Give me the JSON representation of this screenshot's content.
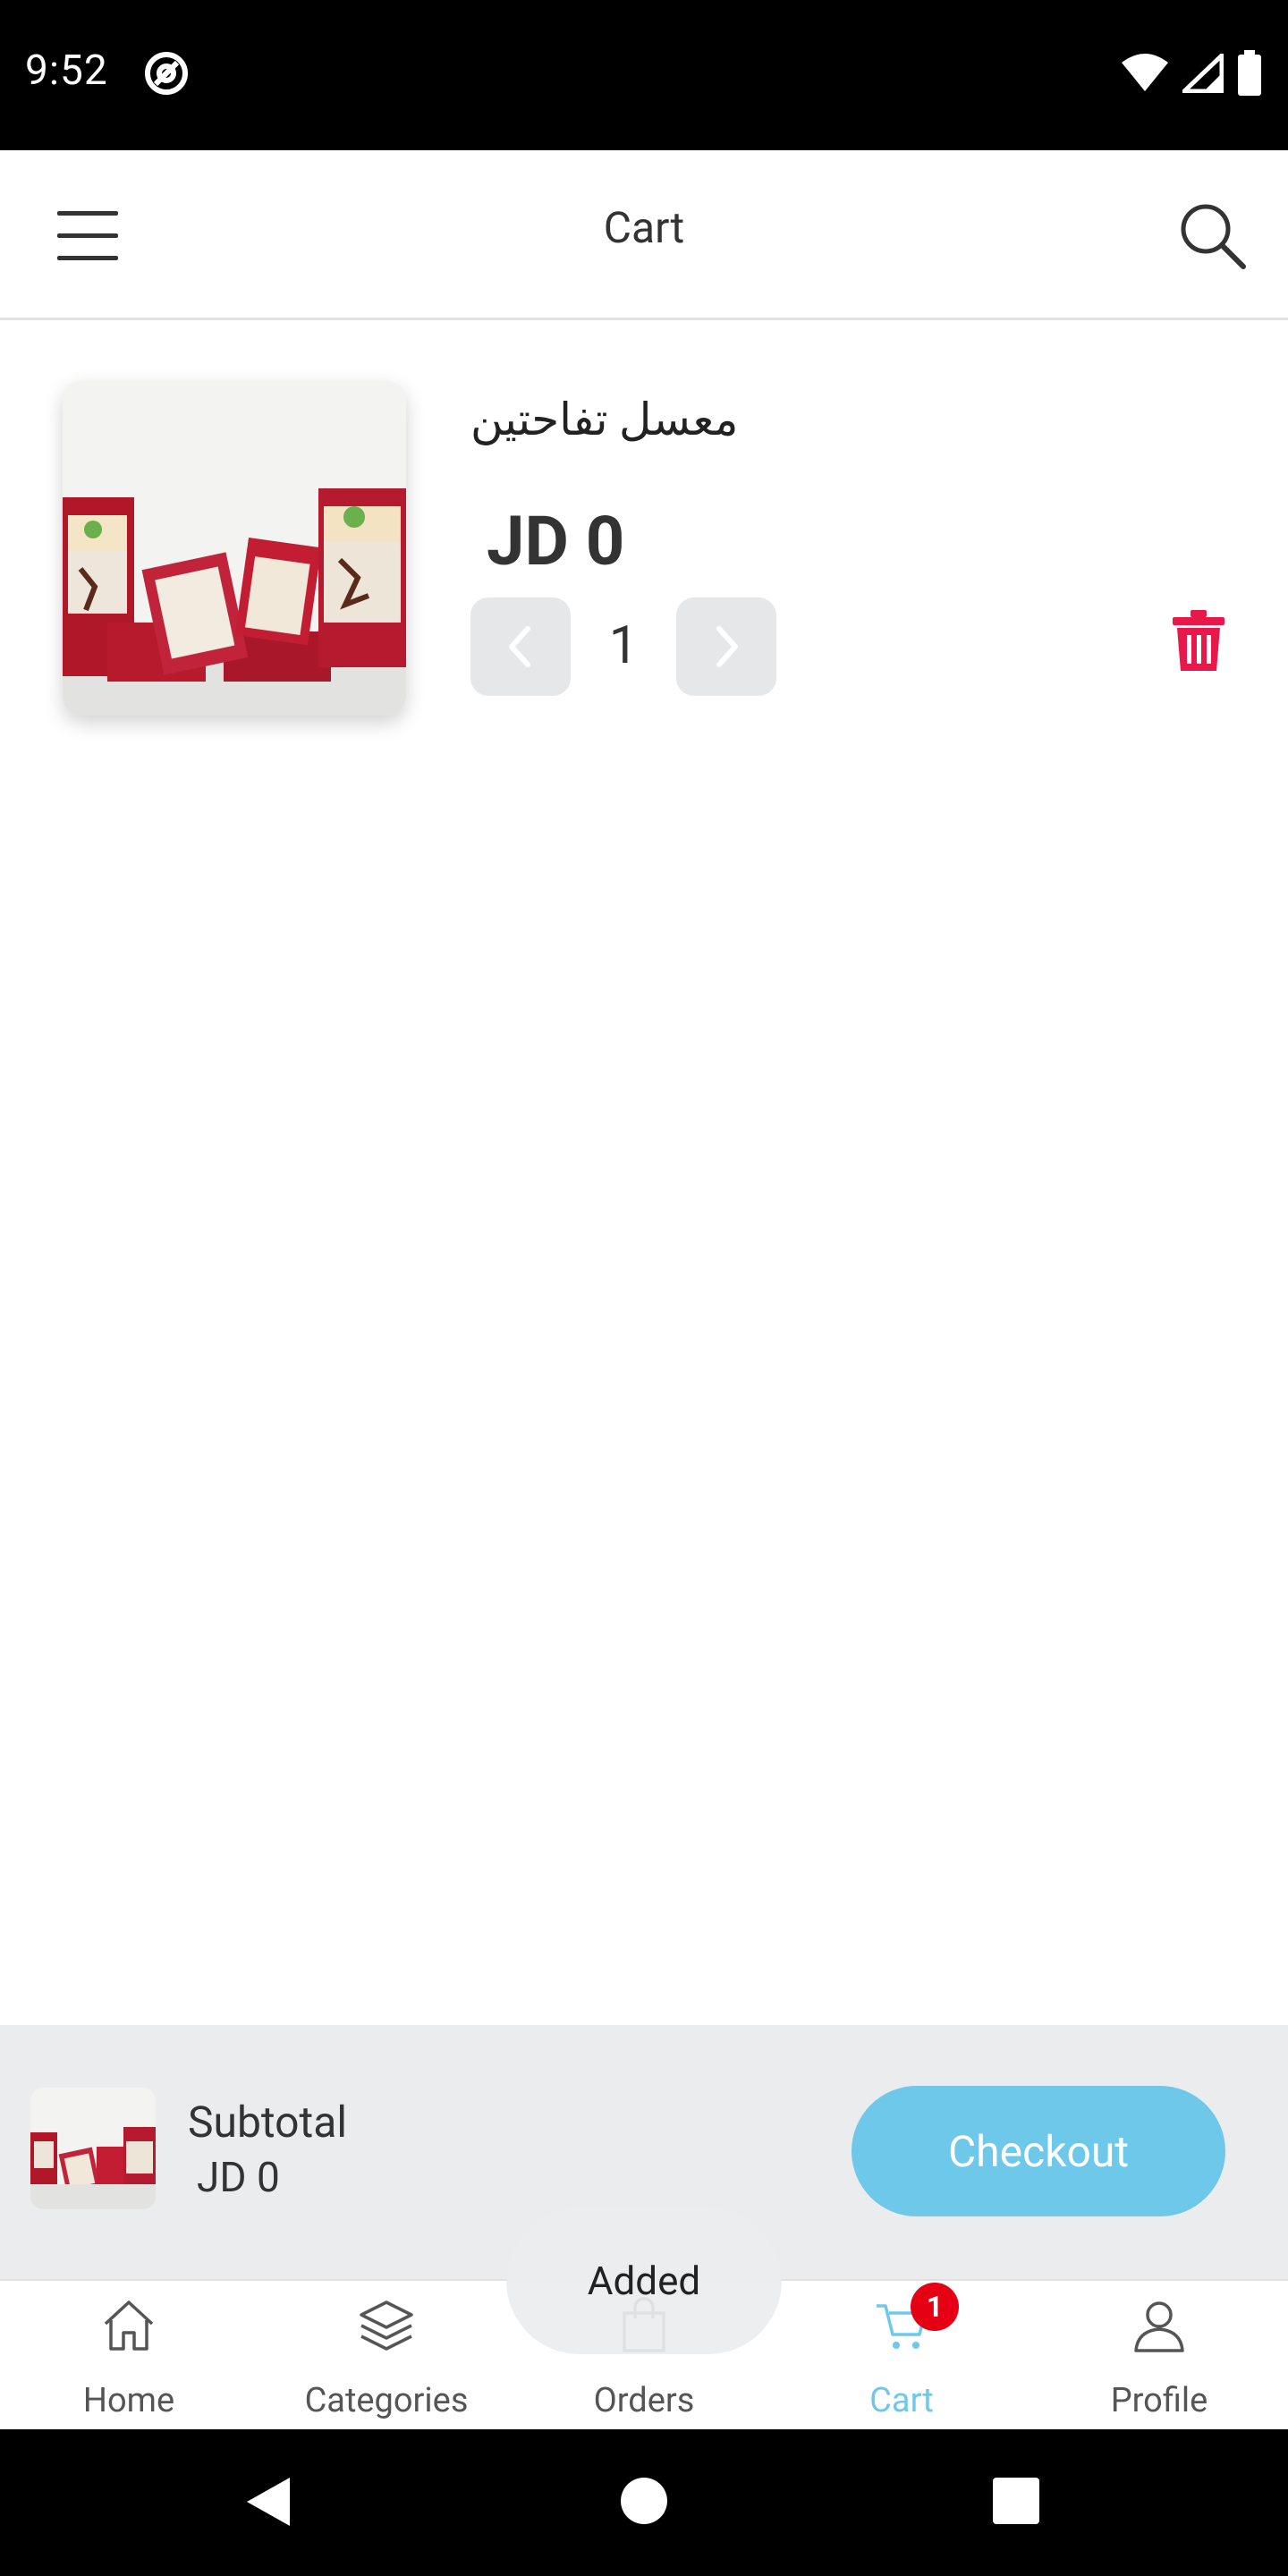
{
  "status_bar": {
    "time": "9:52"
  },
  "app_bar": {
    "title": "Cart"
  },
  "cart_item": {
    "name": "معسل تفاحتين",
    "price": "JD 0",
    "quantity": "1"
  },
  "subtotal": {
    "label": "Subtotal",
    "value": "JD 0",
    "checkout_label": "Checkout"
  },
  "toast": {
    "message": "Added"
  },
  "bottom_nav": {
    "items": [
      {
        "label": "Home",
        "icon": "home-icon"
      },
      {
        "label": "Categories",
        "icon": "layers-icon"
      },
      {
        "label": "Orders",
        "icon": "bag-icon"
      },
      {
        "label": "Cart",
        "icon": "cart-icon",
        "badge": "1",
        "active": true
      },
      {
        "label": "Profile",
        "icon": "user-icon"
      }
    ]
  },
  "colors": {
    "accent": "#6ec8ea",
    "delete": "#e8184a",
    "badge": "#e60013"
  }
}
